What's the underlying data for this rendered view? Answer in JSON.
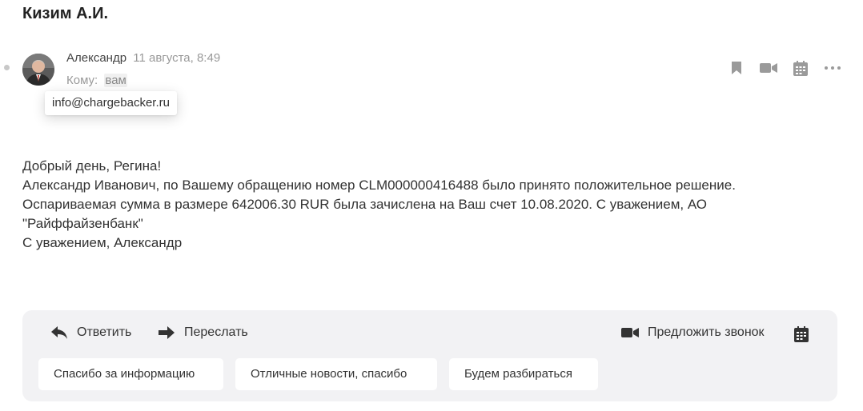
{
  "message": {
    "subject": "Кизим А.И.",
    "sender_name": "Александр",
    "date": "11 августа, 8:49",
    "to_label": "Кому:",
    "to_value": "вам",
    "tooltip_email": "info@chargebacker.ru"
  },
  "top_actions": [
    {
      "icon": "bookmark-icon"
    },
    {
      "icon": "video-call-icon"
    },
    {
      "icon": "calendar-icon"
    },
    {
      "icon": "more-icon"
    }
  ],
  "body": {
    "greeting": "Добрый день, Регина!",
    "line1": "Александр Иванович, по Вашему обращению номер CLM000000416488 было принято положительное решение.",
    "line2": "Оспариваемая сумма в размере 642006.30 RUR была зачислена на Ваш счет 10.08.2020. С уважением, АО",
    "line3": "\"Райффайзенбанк\"",
    "signature": "С уважением, Александр"
  },
  "reply_panel": {
    "reply_label": "Ответить",
    "forward_label": "Переслать",
    "suggest_call_label": "Предложить звонок",
    "quick_replies": [
      "Спасибо за информацию",
      "Отличные новости, спасибо",
      "Будем разбираться"
    ]
  },
  "colors": {
    "panel_bg": "#f2f2f4",
    "icon_gray": "#9a9a9a",
    "icon_dark": "#333333",
    "muted_text": "#999999"
  }
}
